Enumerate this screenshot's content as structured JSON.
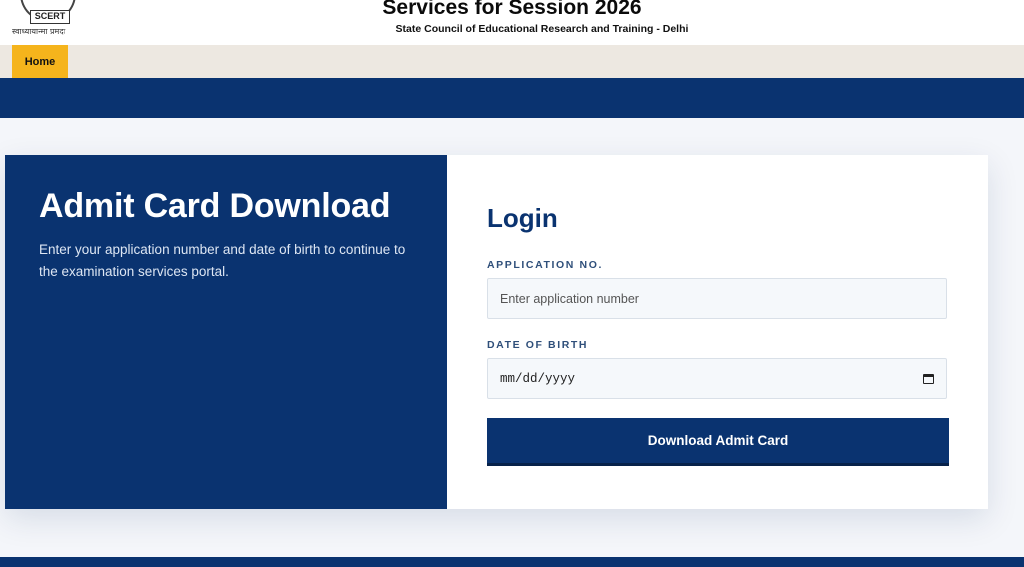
{
  "header": {
    "logo_text": "SCERT",
    "logo_motto": "स्वाध्यायान्मा प्रमदः",
    "title": "Services for Session 2026",
    "subtitle": "State Council of Educational Research and Training - Delhi"
  },
  "nav": {
    "items": [
      {
        "label": "Home",
        "active": true
      }
    ],
    "active_color": "#f5b41c"
  },
  "hero": {
    "title": "Admit Card Download",
    "description": "Enter your application number and date of birth to continue to the examination services portal."
  },
  "login": {
    "title": "Login",
    "application_label": "APPLICATION NO.",
    "application_placeholder": "Enter application number",
    "application_value": "",
    "dob_label": "DATE OF BIRTH",
    "dob_placeholder": "mm/dd/yyyy",
    "dob_icon": "calendar-icon",
    "submit_label": "Download Admit Card"
  },
  "colors": {
    "primary": "#0a3370",
    "accent": "#f5b41c",
    "nav_bg": "#ede8e1"
  }
}
